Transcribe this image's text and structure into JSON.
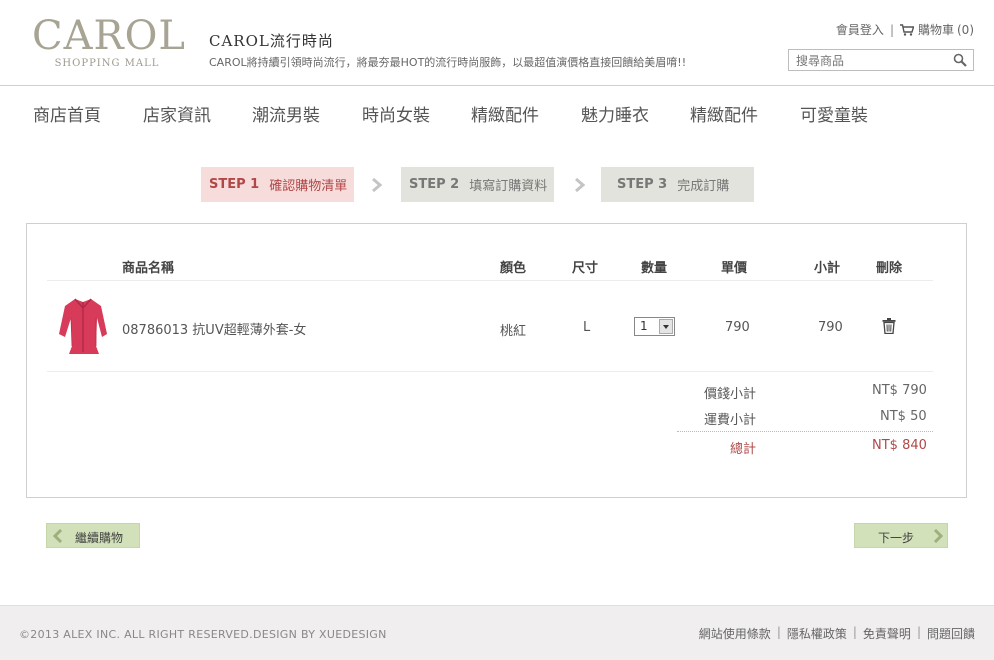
{
  "header": {
    "logo_text": "CAROL",
    "logo_sub": "SHOPPING MALL",
    "brand_title": "CAROL流行時尚",
    "brand_slogan": "CAROL將持續引領時尚流行，將最夯最HOT的流行時尚服飾，以最超值演價格直接回饋給美眉唷!!",
    "login_label": "會員登入",
    "cart_label": "購物車",
    "cart_count": "(0)",
    "search_placeholder": "搜尋商品"
  },
  "nav": {
    "items": [
      {
        "label": "商店首頁"
      },
      {
        "label": "店家資訊"
      },
      {
        "label": "潮流男裝"
      },
      {
        "label": "時尚女裝"
      },
      {
        "label": "精緻配件"
      },
      {
        "label": "魅力睡衣"
      },
      {
        "label": "精緻配件"
      },
      {
        "label": "可愛童裝"
      }
    ]
  },
  "steps": [
    {
      "num": "STEP 1",
      "label": "確認購物清單",
      "active": true
    },
    {
      "num": "STEP 2",
      "label": "填寫訂購資料",
      "active": false
    },
    {
      "num": "STEP 3",
      "label": "完成訂購",
      "active": false
    }
  ],
  "cart": {
    "columns": {
      "name": "商品名稱",
      "color": "顏色",
      "size": "尺寸",
      "qty": "數量",
      "price": "單價",
      "subtotal": "小計",
      "delete": "刪除"
    },
    "items": [
      {
        "name": "08786013 抗UV超輕薄外套-女",
        "color": "桃紅",
        "size": "L",
        "qty": "1",
        "price": "790",
        "subtotal": "790"
      }
    ],
    "summary": {
      "items_label": "價錢小計",
      "items_value": "NT$ 790",
      "shipping_label": "運費小計",
      "shipping_value": "NT$ 50",
      "total_label": "總計",
      "total_value": "NT$ 840"
    }
  },
  "buttons": {
    "back_label": "繼續購物",
    "next_label": "下一步"
  },
  "footer": {
    "copyright": "©2013 ALEX INC. ALL RIGHT RESERVED.DESIGN BY XUEDESIGN",
    "links": [
      "網站使用條款",
      "隱私權政策",
      "免責聲明",
      "問題回饋"
    ]
  },
  "colors": {
    "accent_red": "#b04848",
    "step_active_bg": "#f7dcdc",
    "step_inactive_bg": "#e1e3dc",
    "button_green": "#d2e1b9",
    "logo_color": "#a7a494"
  },
  "icons": [
    "cart-icon",
    "search-icon",
    "step-arrow-icon",
    "trash-icon",
    "chevron-left-icon",
    "chevron-right-icon"
  ]
}
